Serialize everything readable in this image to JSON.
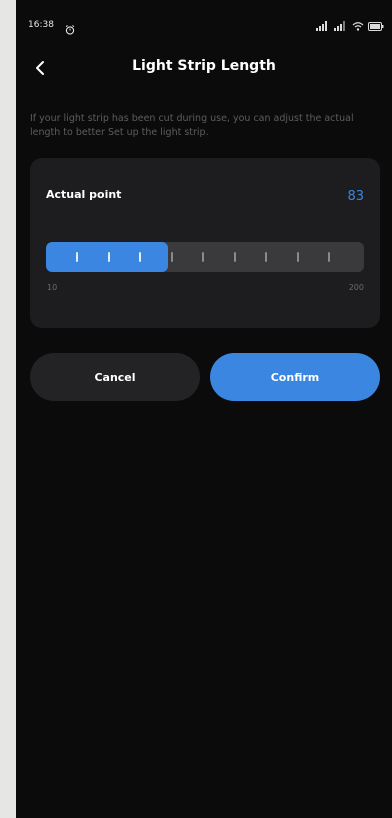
{
  "status_bar": {
    "time": "16:38",
    "icons": [
      "alarm-icon",
      "signal-icon",
      "signal-icon",
      "wifi-icon",
      "battery-icon"
    ]
  },
  "header": {
    "title": "Light Strip Length",
    "back_icon": "chevron-left-icon"
  },
  "description": "If your light strip has been cut during use, you can adjust the actual length to better Set up the light strip.",
  "card": {
    "label": "Actual point",
    "value": "83",
    "slider": {
      "min": 10,
      "max": 200,
      "current": 83,
      "min_label": "10",
      "max_label": "200"
    }
  },
  "buttons": {
    "cancel_label": "Cancel",
    "confirm_label": "Confirm"
  },
  "colors": {
    "background": "#0b0b0c",
    "card": "#1d1d1f",
    "accent": "#3a86e0",
    "track": "#3a3a3c",
    "cancel_button": "#232325",
    "muted_text": "#5d5d60"
  }
}
